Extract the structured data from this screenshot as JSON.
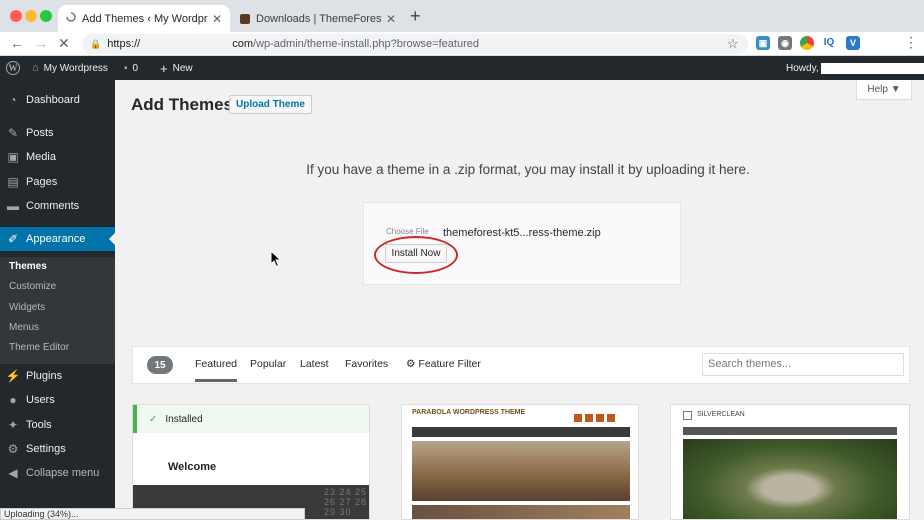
{
  "browser": {
    "tabs": [
      {
        "title": "Add Themes ‹ My Wordpress —",
        "active": true
      },
      {
        "title": "Downloads | ThemeForest",
        "active": false
      }
    ],
    "url_prefix": "https://",
    "url_domain_suffix": "com",
    "url_path": "/wp-admin/theme-install.php?browse=featured",
    "status_text": "Uploading (34%)..."
  },
  "adminbar": {
    "site_name": "My Wordpress",
    "comments_count": "0",
    "new_label": "New",
    "howdy": "Howdy,"
  },
  "sidebar": {
    "items": [
      {
        "label": "Dashboard",
        "icon": "dashboard-icon"
      },
      {
        "label": "Posts",
        "icon": "pin-icon"
      },
      {
        "label": "Media",
        "icon": "media-icon"
      },
      {
        "label": "Pages",
        "icon": "page-icon"
      },
      {
        "label": "Comments",
        "icon": "comment-icon"
      },
      {
        "label": "Appearance",
        "icon": "brush-icon"
      },
      {
        "label": "Plugins",
        "icon": "plugin-icon"
      },
      {
        "label": "Users",
        "icon": "user-icon"
      },
      {
        "label": "Tools",
        "icon": "wrench-icon"
      },
      {
        "label": "Settings",
        "icon": "settings-icon"
      },
      {
        "label": "Collapse menu",
        "icon": "collapse-icon"
      }
    ],
    "submenu": [
      "Themes",
      "Customize",
      "Widgets",
      "Menus",
      "Theme Editor"
    ]
  },
  "main": {
    "title": "Add Themes",
    "upload_theme_label": "Upload Theme",
    "help_label": "Help ▼",
    "upload_message": "If you have a theme in a .zip format, you may install it by uploading it here.",
    "choose_file_label": "Choose File",
    "file_name": "themeforest-kt5...ress-theme.zip",
    "install_now_label": "Install Now"
  },
  "filter": {
    "count": "15",
    "tabs": [
      "Featured",
      "Popular",
      "Latest",
      "Favorites"
    ],
    "feature_filter_label": "Feature Filter",
    "search_placeholder": "Search themes..."
  },
  "cards": [
    {
      "installed_label": "Installed",
      "welcome": "Welcome",
      "numbers": "23 24 25\n26 27 28\n29 30\n    "
    },
    {
      "heading": "PARABOLA WORDPRESS THEME"
    },
    {
      "heading": "SILVERCLEAN"
    }
  ],
  "colors": {
    "admin_dark": "#23282d",
    "accent": "#0073aa",
    "installed_green": "#46b450",
    "annotation_red": "#d0262b"
  }
}
